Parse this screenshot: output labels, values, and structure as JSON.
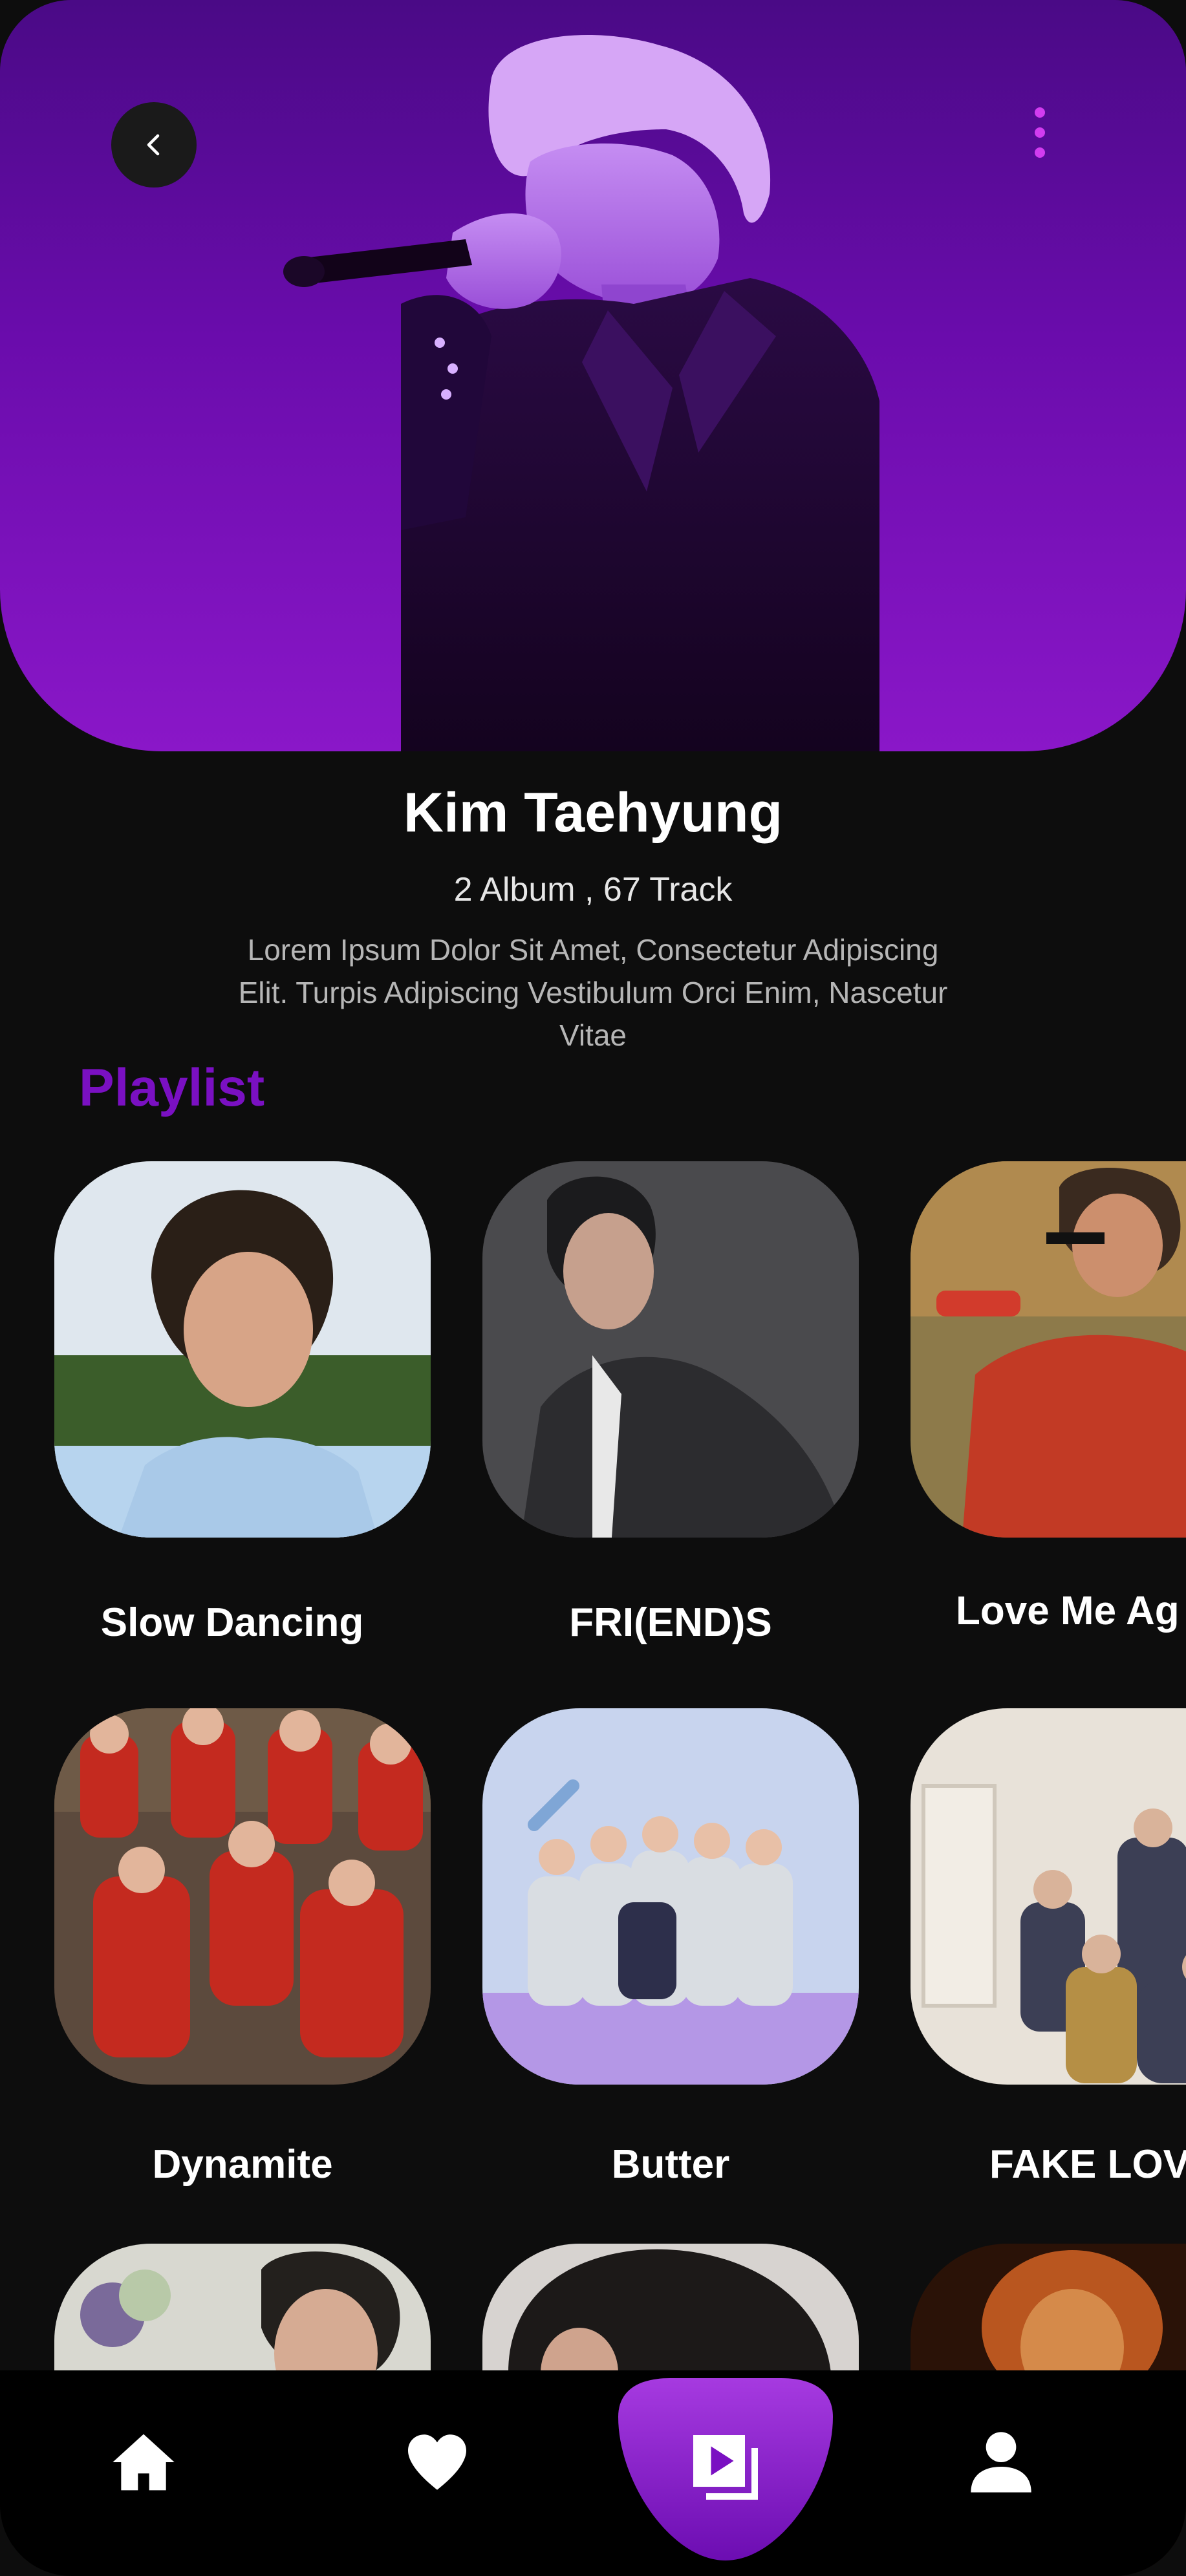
{
  "header": {
    "back_icon": "chevron-left-icon",
    "more_icon": "vertical-dots-icon",
    "accent_color": "#d23cf0"
  },
  "artist": {
    "name": "Kim Taehyung",
    "meta": "2 Album , 67 Track",
    "description": "Lorem Ipsum Dolor Sit Amet, Consectetur Adipiscing Elit. Turpis Adipiscing Vestibulum Orci Enim, Nascetur Vitae"
  },
  "playlist": {
    "title": "Playlist",
    "title_color": "#7a10c2",
    "items": [
      {
        "label": "Slow Dancing"
      },
      {
        "label": "FRI(END)S"
      },
      {
        "label": "Love Me Ag"
      },
      {
        "label": "Dynamite"
      },
      {
        "label": "Butter"
      },
      {
        "label": "FAKE LOV"
      }
    ]
  },
  "bottom_nav": {
    "items": [
      {
        "icon": "home-icon"
      },
      {
        "icon": "heart-icon"
      },
      {
        "icon": "playlist-play-icon",
        "active": true
      },
      {
        "icon": "user-icon"
      }
    ],
    "active_color": "#8a17c8"
  }
}
